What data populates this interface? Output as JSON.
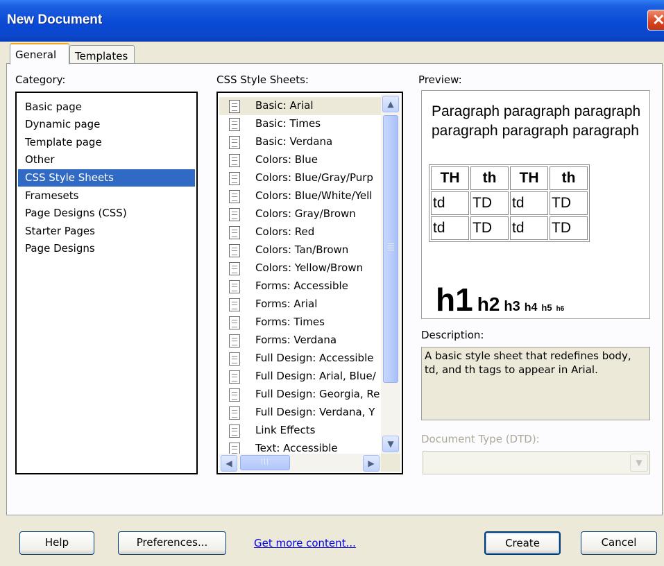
{
  "window": {
    "title": "New Document",
    "close_icon": "close-icon"
  },
  "tabs": [
    {
      "label": "General",
      "active": true
    },
    {
      "label": "Templates",
      "active": false
    }
  ],
  "category": {
    "label": "Category:",
    "items": [
      "Basic page",
      "Dynamic page",
      "Template page",
      "Other",
      "CSS Style Sheets",
      "Framesets",
      "Page Designs (CSS)",
      "Starter Pages",
      "Page Designs"
    ],
    "selected": "CSS Style Sheets"
  },
  "css_sheets": {
    "label": "CSS Style Sheets:",
    "items": [
      "Basic: Arial",
      "Basic: Times",
      "Basic: Verdana",
      "Colors: Blue",
      "Colors: Blue/Gray/Purp",
      "Colors: Blue/White/Yell",
      "Colors: Gray/Brown",
      "Colors: Red",
      "Colors: Tan/Brown",
      "Colors: Yellow/Brown",
      "Forms: Accessible",
      "Forms: Arial",
      "Forms: Times",
      "Forms: Verdana",
      "Full Design: Accessible",
      "Full Design: Arial, Blue/",
      "Full Design: Georgia, Re",
      "Full Design: Verdana, Y",
      "Link Effects",
      "Text: Accessible"
    ],
    "selected": "Basic: Arial",
    "item_icon": "document-icon"
  },
  "preview": {
    "label": "Preview:",
    "paragraph_line1": "Paragraph paragraph paragraph",
    "paragraph_line2": "paragraph paragraph paragraph",
    "table_header": [
      "TH",
      "th",
      "TH",
      "th"
    ],
    "table_rows": [
      [
        "td",
        "TD",
        "td",
        "TD"
      ],
      [
        "td",
        "TD",
        "td",
        "TD"
      ]
    ],
    "headings": [
      "h1",
      "h2",
      "h3",
      "h4",
      "h5",
      "h6"
    ]
  },
  "description": {
    "label": "Description:",
    "text": "A basic style sheet that redefines body, td, and th tags to appear in Arial."
  },
  "doctype": {
    "label": "Document Type (DTD):",
    "value": "",
    "enabled": false
  },
  "buttons": {
    "help": "Help",
    "preferences": "Preferences...",
    "get_more": "Get more content...",
    "create": "Create",
    "cancel": "Cancel"
  }
}
